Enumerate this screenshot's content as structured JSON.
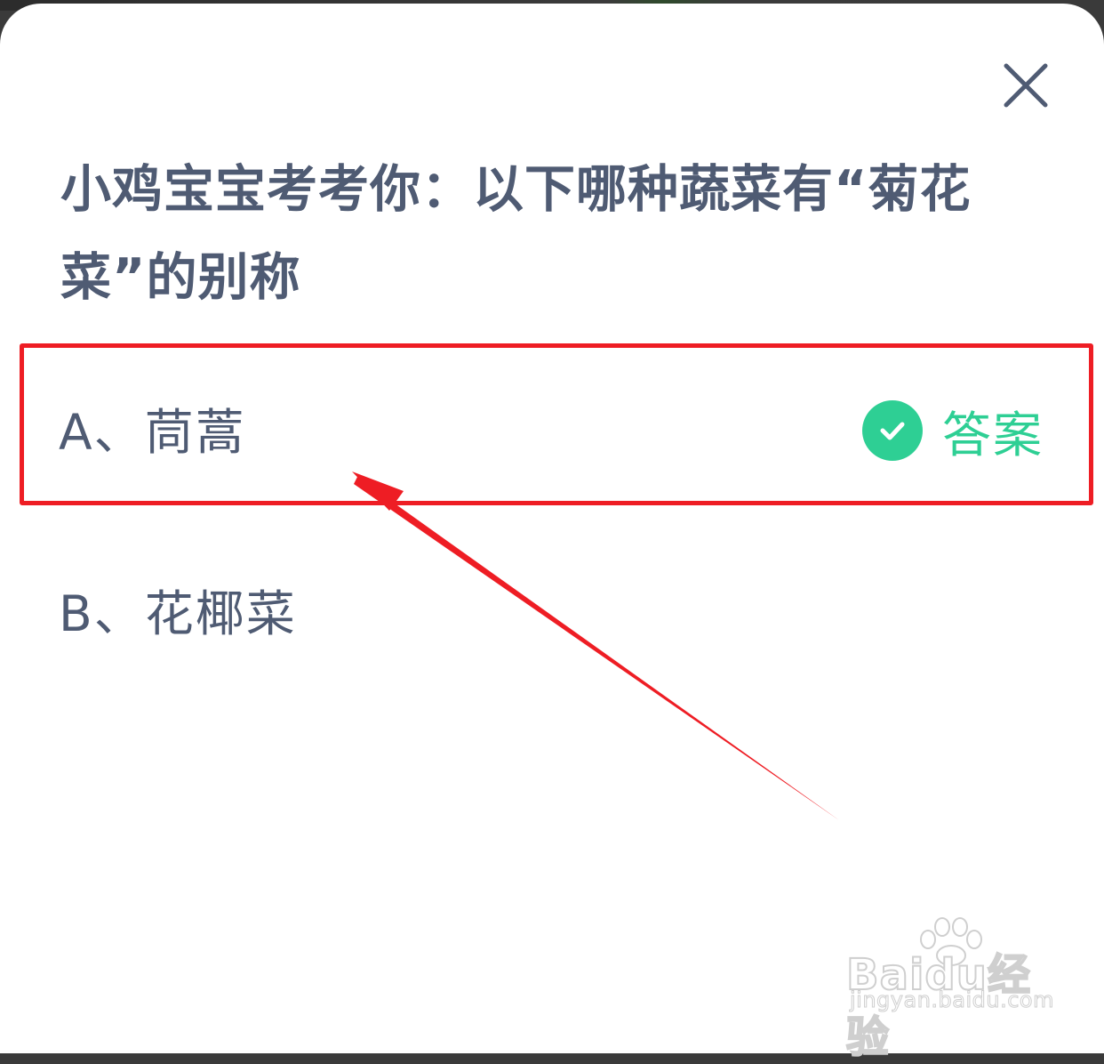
{
  "quiz": {
    "question": "小鸡宝宝考考你：以下哪种蔬菜有“菊花菜”的别称",
    "options": [
      {
        "label": "A、茼蒿",
        "is_answer": true
      },
      {
        "label": "B、花椰菜",
        "is_answer": false
      }
    ],
    "answer_badge": {
      "label": "答案",
      "icon": "check-circle-icon"
    },
    "close_icon": "close-icon"
  },
  "colors": {
    "question_text": "#4f5b73",
    "option_text": "#4f5b73",
    "answer_green": "#2ecf94",
    "annotation_red": "#ee1d24",
    "sheet_background": "#ffffff"
  },
  "watermark": {
    "logo": "Baidu经验",
    "url": "jingyan.baidu.com"
  }
}
